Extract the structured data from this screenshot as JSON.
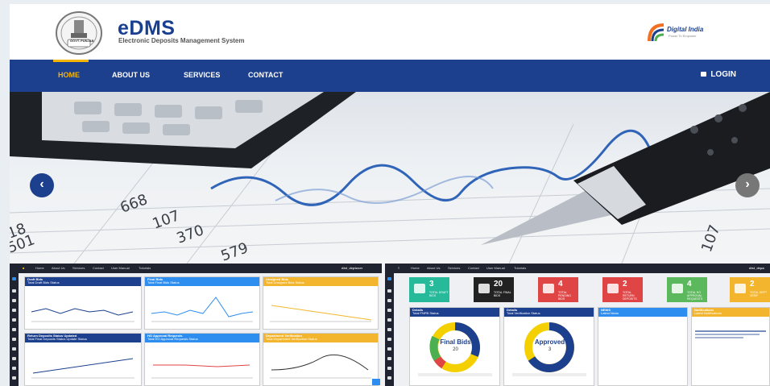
{
  "header": {
    "brand_title": "eDMS",
    "brand_subtitle": "Electronic Deposits Management System",
    "emblem_text": "GOVT. PUNJAB",
    "digital_india": "Digital India",
    "digital_india_tag": "Power To Empower"
  },
  "nav": {
    "items": [
      {
        "label": "HOME"
      },
      {
        "label": "ABOUT US"
      },
      {
        "label": "SERVICES"
      },
      {
        "label": "CONTACT"
      }
    ],
    "login": "LOGIN"
  },
  "hero": {
    "numbers": [
      "668",
      "107",
      "370",
      "579",
      "501",
      "18",
      "107"
    ],
    "prev": "‹",
    "next": "›"
  },
  "screenshot_left": {
    "menu": [
      "Home",
      "About Us",
      "Services",
      "Contact",
      "User Manual",
      "Tutorials"
    ],
    "user": "dist_deptuser",
    "panels": [
      {
        "title": "Draft Bids",
        "sub": "Total Draft Bids Status"
      },
      {
        "title": "Final Bids",
        "sub": "Total Final Bids Status"
      },
      {
        "title": "Unsigned Bids",
        "sub": "Total Unsigned Bids Status"
      },
      {
        "title": "Return Deposits Status Updated",
        "sub": "Total Final Deposits Status Update Status"
      },
      {
        "title": "HO Approval Requests",
        "sub": "Total HO Approval Requests Status"
      },
      {
        "title": "Department Verification",
        "sub": "Total Department Verification Status"
      }
    ]
  },
  "screenshot_right": {
    "menu": [
      "Home",
      "About Us",
      "Services",
      "Contact",
      "User Manual",
      "Tutorials"
    ],
    "user": "dist_depa",
    "stats": [
      {
        "num": "3",
        "label": "TOTAL DRAFT BIDS",
        "color": "#26b99a"
      },
      {
        "num": "20",
        "label": "TOTAL FINAL BIDS",
        "color": "#222222"
      },
      {
        "num": "4",
        "label": "TOTAL PENDING BIDS",
        "color": "#e04545"
      },
      {
        "num": "2",
        "label": "TOTAL RETURN DEPOSITS",
        "color": "#e04545"
      },
      {
        "num": "4",
        "label": "TOTAL HO APPROVAL REQUESTS",
        "color": "#5cb85c"
      },
      {
        "num": "2",
        "label": "TOTAL DEPT VERIF",
        "color": "#f2b52d"
      }
    ],
    "panels": [
      {
        "title": "Details",
        "sub": "Total FNPB Status"
      },
      {
        "title": "Details",
        "sub": "Total Verification Status"
      },
      {
        "title": "NEWS",
        "sub": "Latest News"
      },
      {
        "title": "Notifications",
        "sub": "Latest Notifications"
      }
    ],
    "donut1_label": "Final Bids",
    "donut1_value": "20",
    "donut2_label": "Approved",
    "donut2_value": "3"
  },
  "colors": {
    "navy": "#1c3f8e",
    "gold": "#f5b400",
    "blue": "#2d8ef0"
  }
}
